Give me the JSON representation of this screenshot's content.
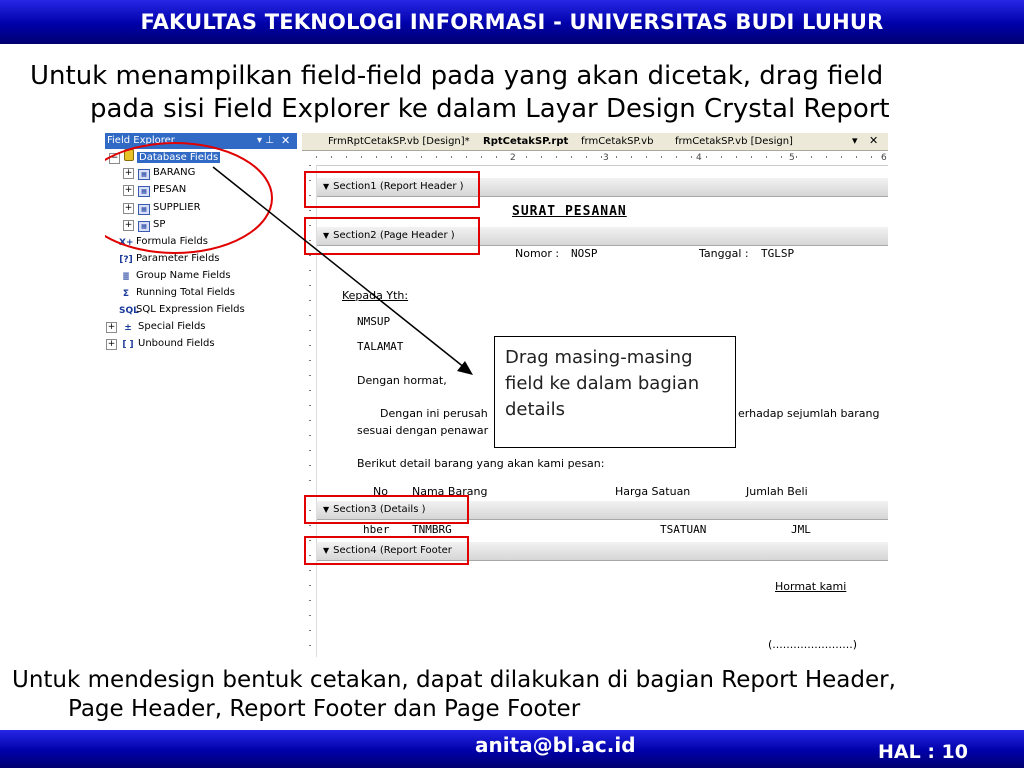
{
  "header": {
    "title": "FAKULTAS TEKNOLOGI INFORMASI - UNIVERSITAS BUDI LUHUR"
  },
  "intro": {
    "line1": "Untuk menampilkan field-field pada yang akan dicetak, drag field",
    "line2": "pada sisi Field Explorer ke dalam Layar Design Crystal Report"
  },
  "field_explorer": {
    "title": "Field Explorer",
    "pin": "▾ ⊥",
    "close": "✕",
    "database_fields": "Database Fields",
    "tables": [
      "BARANG",
      "PESAN",
      "SUPPLIER",
      "SP"
    ],
    "other_nodes": [
      "Formula Fields",
      "Parameter Fields",
      "Group Name Fields",
      "Running Total Fields",
      "SQL Expression Fields",
      "Special Fields",
      "Unbound Fields"
    ]
  },
  "tabs": [
    "FrmRptCetakSP.vb [Design]*",
    "RptCetakSP.rpt",
    "frmCetakSP.vb",
    "frmCetakSP.vb [Design]"
  ],
  "tab_controls": {
    "dropdown": "▾",
    "close": "✕"
  },
  "ruler": [
    "2",
    "3",
    "4",
    "5",
    "6"
  ],
  "sections": {
    "s1": "Section1 (Report Header  )",
    "s2": "Section2 (Page Header  )",
    "s3": "Section3 (Details  )",
    "s4": "Section4 (Report Footer"
  },
  "report": {
    "title": "SURAT PESANAN",
    "nomor_label": "Nomor :",
    "nomor_field": "NOSP",
    "tanggal_label": "Tanggal :",
    "tanggal_field": "TGLSP",
    "kepada": "Kepada Yth:",
    "nmsup": "NMSUP",
    "alamat": "TALAMAT",
    "dengan_hormat": "Dengan hormat,",
    "body1_left": "Dengan ini perusah",
    "body1_right": "erhadap sejumlah barang",
    "body2": "sesuai dengan penawar",
    "berikut": "Berikut detail barang yang akan kami pesan:",
    "col_no": "No",
    "col_nama": "Nama Barang",
    "col_harga": "Harga Satuan",
    "col_jumlah": "Jumlah Beli",
    "d_no": "hber",
    "d_nmbrg": "TNMBRG",
    "d_harga": "TSATUAN",
    "d_jml": "JML",
    "hormat_kami": "Hormat kami",
    "signature": "(.......................)"
  },
  "callout": [
    "Drag masing-masing",
    "field ke dalam bagian",
    "details"
  ],
  "outro": {
    "line1": "Untuk mendesign bentuk cetakan, dapat dilakukan di bagian Report Header,",
    "line2": "Page Header, Report Footer dan Page Footer"
  },
  "footer": {
    "email": "anita@bl.ac.id",
    "page": "HAL : 10"
  }
}
